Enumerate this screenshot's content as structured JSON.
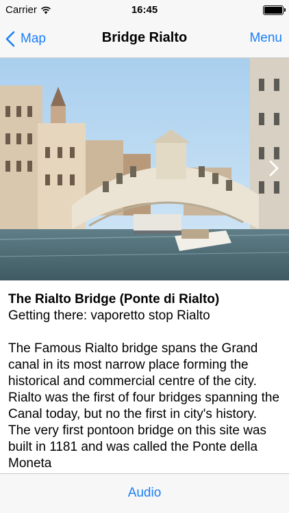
{
  "status_bar": {
    "carrier": "Carrier",
    "time": "16:45",
    "battery_level": 1.0
  },
  "nav": {
    "back_label": "Map",
    "title": "Bridge Rialto",
    "menu_label": "Menu"
  },
  "content": {
    "title": "The Rialto Bridge (Ponte di Rialto)",
    "subtitle": "Getting there: vaporetto stop Rialto",
    "paragraph1": "The Famous Rialto bridge spans the Grand canal in its most narrow place forming  the historical and commercial centre of the city. Rialto was the first of four bridges spanning the Canal today, but no the first in city's history.",
    "paragraph2": "The very first pontoon bridge on this site was built in 1181 and was called the Ponte della Moneta"
  },
  "toolbar": {
    "audio_label": "Audio"
  },
  "colors": {
    "accent": "#1a7ef7",
    "bar_background": "#f7f7f7"
  },
  "icons": {
    "back": "chevron-left-icon",
    "next": "chevron-right-icon",
    "wifi": "wifi-icon",
    "battery": "battery-icon"
  }
}
